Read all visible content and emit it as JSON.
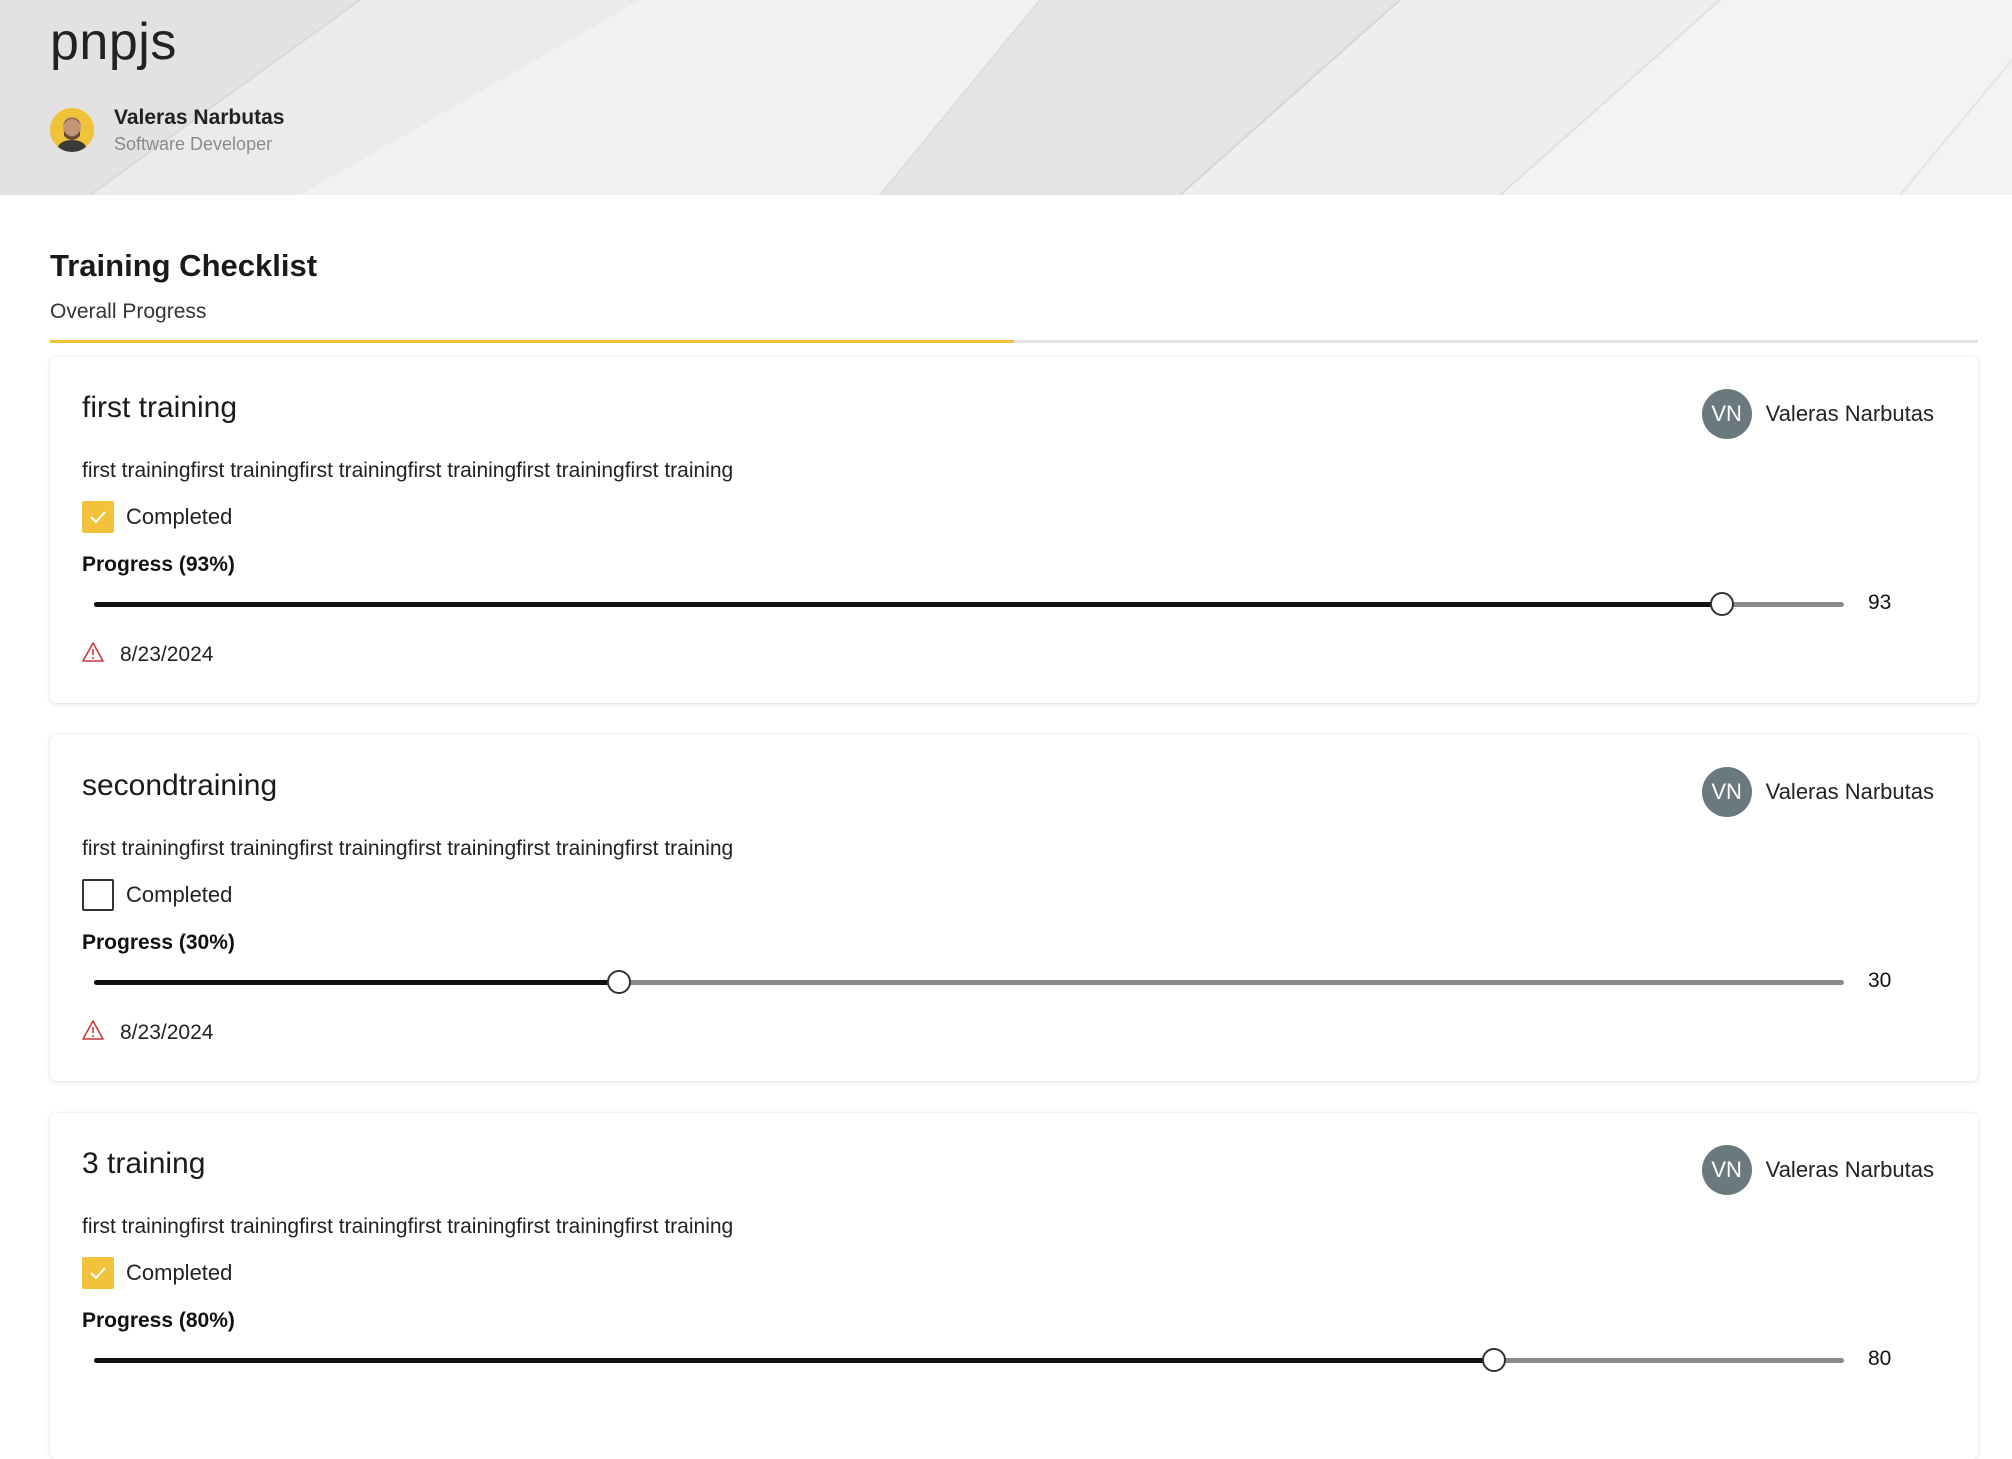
{
  "header": {
    "site_title": "pnpjs",
    "author": {
      "name": "Valeras Narbutas",
      "role": "Software Developer"
    }
  },
  "checklist": {
    "title": "Training Checklist",
    "overall_label": "Overall Progress",
    "overall_progress_fraction": 0.5,
    "colors": {
      "accent": "#f2c23a",
      "persona": "#69797e",
      "warning": "#d13438"
    },
    "items": [
      {
        "title": "first training",
        "assignee_initials": "VN",
        "assignee_name": "Valeras Narbutas",
        "description": "first trainingfirst trainingfirst trainingfirst trainingfirst trainingfirst training",
        "completed": true,
        "completed_label": "Completed",
        "progress_label": "Progress (93%)",
        "progress": 93,
        "progress_value_text": "93",
        "warning_icon": "warning-icon",
        "due_date": "8/23/2024"
      },
      {
        "title": "secondtraining",
        "assignee_initials": "VN",
        "assignee_name": "Valeras Narbutas",
        "description": "first trainingfirst trainingfirst trainingfirst trainingfirst trainingfirst training",
        "completed": false,
        "completed_label": "Completed",
        "progress_label": "Progress (30%)",
        "progress": 30,
        "progress_value_text": "30",
        "warning_icon": "warning-icon",
        "due_date": "8/23/2024"
      },
      {
        "title": "3 training",
        "assignee_initials": "VN",
        "assignee_name": "Valeras Narbutas",
        "description": "first trainingfirst trainingfirst trainingfirst trainingfirst trainingfirst training",
        "completed": true,
        "completed_label": "Completed",
        "progress_label": "Progress (80%)",
        "progress": 80,
        "progress_value_text": "80",
        "warning_icon": "warning-icon",
        "due_date": ""
      }
    ]
  }
}
